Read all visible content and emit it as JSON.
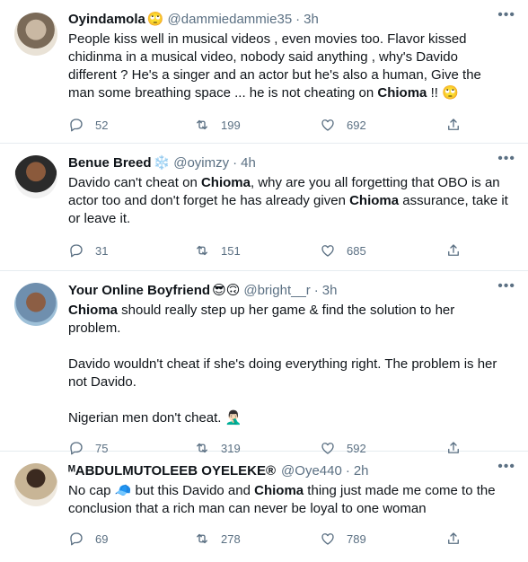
{
  "tweets": [
    {
      "name": "Oyindamola",
      "emojis": "🙄",
      "handle": "@dammiedammie35",
      "time": "3h",
      "text_html": "People kiss well in musical videos , even movies too. Flavor kissed chidinma in a musical video, nobody said anything , why's Davido different ? He's a singer and an actor but he's also a human, Give the man some breathing space ... he is not cheating on <b>Chioma</b> !! 🙄",
      "replies": "52",
      "retweets": "199",
      "likes": "692"
    },
    {
      "name": "Benue Breed",
      "emojis": "❄️",
      "handle": "@oyimzy",
      "time": "4h",
      "text_html": "Davido can't cheat on <b>Chioma</b>, why are you all forgetting that OBO is an actor too and don't forget he has already given <b>Chioma</b> assurance, take it or leave it.",
      "replies": "31",
      "retweets": "151",
      "likes": "685"
    },
    {
      "name": "Your Online Boyfriend",
      "emojis": "😎🙃",
      "handle": "@bright__r",
      "time": "3h",
      "text_html": "<p><b>Chioma</b> should really step up her game &amp; find the solution to her problem.</p><p>Davido wouldn't cheat if she's doing everything right. The problem is her not Davido.</p><p>Nigerian men don't cheat. 🤦🏻‍♂️</p>",
      "replies": "75",
      "retweets": "319",
      "likes": "592"
    },
    {
      "name": "ᴹABDULMUTOLEEB OYELEKE®",
      "emojis": "",
      "handle": "@Oye440",
      "time": "2h",
      "text_html": "No cap 🧢 but this Davido and <b>Chioma</b> thing just made me come to the conclusion that a rich man can never be loyal to one woman",
      "replies": "69",
      "retweets": "278",
      "likes": "789"
    }
  ],
  "icons": {
    "reply": "reply-icon",
    "retweet": "retweet-icon",
    "like": "heart-icon",
    "share": "share-icon",
    "more": "more-icon"
  },
  "colors": {
    "text": "#0f1419",
    "muted": "#5b7083",
    "divider": "#e6ecf0"
  }
}
